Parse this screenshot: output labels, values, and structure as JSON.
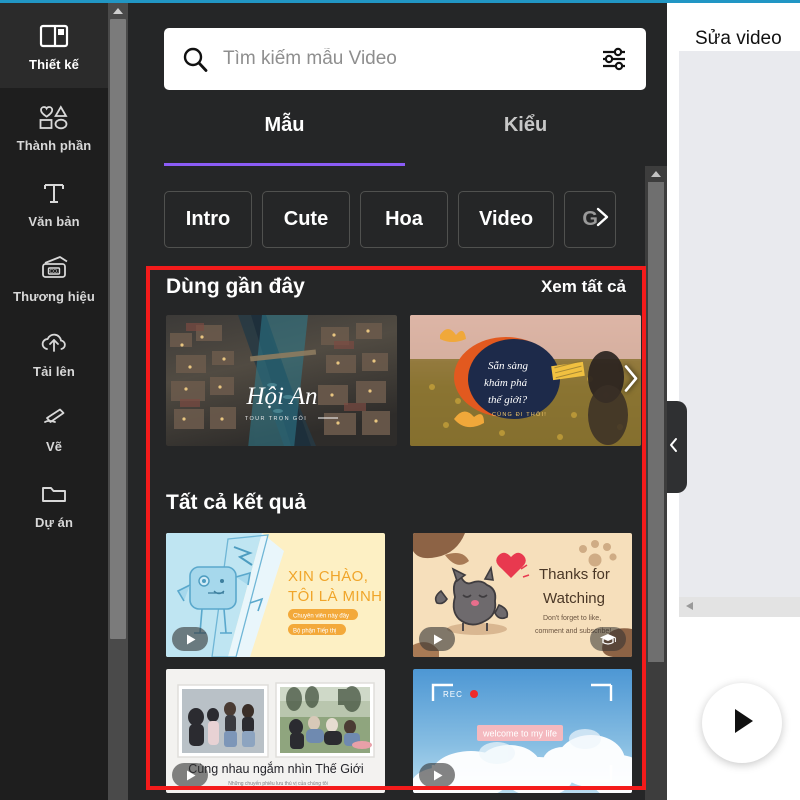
{
  "sidebar": {
    "items": [
      {
        "label": "Thiết kế",
        "icon": "layout-icon",
        "active": true
      },
      {
        "label": "Thành phần",
        "icon": "shapes-icon",
        "active": false
      },
      {
        "label": "Văn bản",
        "icon": "text-t-icon",
        "active": false
      },
      {
        "label": "Thương hiệu",
        "icon": "brand-card-icon",
        "active": false
      },
      {
        "label": "Tải lên",
        "icon": "upload-cloud-icon",
        "active": false
      },
      {
        "label": "Vẽ",
        "icon": "pen-draw-icon",
        "active": false
      },
      {
        "label": "Dự án",
        "icon": "folder-icon",
        "active": false
      }
    ]
  },
  "search": {
    "placeholder": "Tìm kiếm mẫu Video",
    "value": "",
    "filter_icon": "sliders-filter-icon",
    "search_icon": "search-icon"
  },
  "tabs": [
    {
      "label": "Mẫu",
      "active": true
    },
    {
      "label": "Kiểu",
      "active": false
    }
  ],
  "chips": [
    {
      "label": "Intro"
    },
    {
      "label": "Cute"
    },
    {
      "label": "Hoa"
    },
    {
      "label": "Video"
    },
    {
      "label": "G"
    }
  ],
  "recent": {
    "title": "Dùng gần đây",
    "see_all": "Xem tất cả",
    "items": [
      {
        "name": "Hội An",
        "caption_main": "Hội An",
        "caption_sub": "TOUR TRỌN GÓI"
      },
      {
        "name": "Sẵn sàng khám phá thế giới?",
        "caption_main": "Sẵn sàng khám phá thế giới?",
        "caption_sub": "CÙNG ĐI THÔI!"
      }
    ],
    "next_arrow_icon": "chevron-right-icon"
  },
  "results": {
    "title": "Tất cả kết quả",
    "items": [
      {
        "name": "Xin chào tôi là Minh",
        "line1": "XIN CHÀO,",
        "line2": "TÔI LÀ MINH",
        "tag1": "Chuyên viên này đây",
        "tag2": "Bộ phận Tiếp thị",
        "badge": "play-icon"
      },
      {
        "name": "Thanks for Watching",
        "line1": "Thanks for",
        "line2": "Watching",
        "sub1": "Don't forget to like,",
        "sub2": "comment and subscribe!",
        "badge": "play-icon",
        "badge2": "graduation-cap-icon"
      },
      {
        "name": "Cùng nhau ngắm nhìn Thế Giới",
        "line1": "Cùng nhau ngắm nhìn Thế Giới",
        "sub1": "Những chuyến phiêu lưu thú vị của chúng tôi",
        "badge": "play-icon"
      },
      {
        "name": "Welcome to my life",
        "rec_label": "REC",
        "line1": "welcome to my life",
        "badge": "play-icon"
      }
    ]
  },
  "editor": {
    "title": "Sửa video",
    "collapse_icon": "chevron-left-icon",
    "play_icon": "play-triangle-icon",
    "ruler_icon": "triangle-left-icon"
  },
  "scrollbars": {
    "rail_up_icon": "caret-up-icon",
    "panel_up_icon": "caret-up-icon"
  },
  "annotation": {
    "color": "#f41b1b"
  }
}
